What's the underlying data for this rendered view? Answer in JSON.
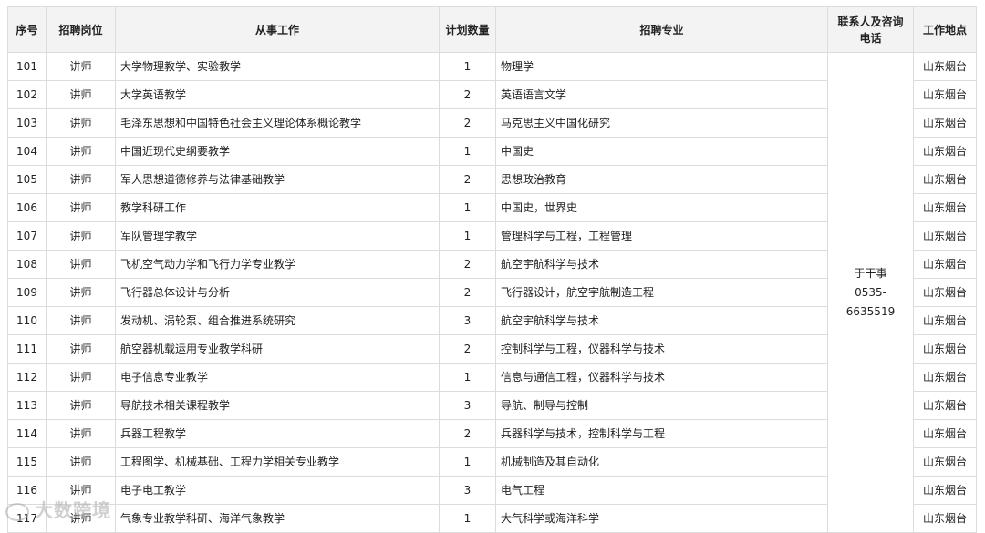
{
  "headers": {
    "seq": "序号",
    "post": "招聘岗位",
    "work": "从事工作",
    "count": "计划数量",
    "major": "招聘专业",
    "contact": "联系人及咨询电话",
    "location": "工作地点"
  },
  "contact": {
    "name": "于干事",
    "phone_1": "0535-",
    "phone_2": "6635519"
  },
  "rows": [
    {
      "seq": "101",
      "post": "讲师",
      "work": "大学物理教学、实验教学",
      "count": "1",
      "major": "物理学",
      "location": "山东烟台"
    },
    {
      "seq": "102",
      "post": "讲师",
      "work": "大学英语教学",
      "count": "2",
      "major": "英语语言文学",
      "location": "山东烟台"
    },
    {
      "seq": "103",
      "post": "讲师",
      "work": "毛泽东思想和中国特色社会主义理论体系概论教学",
      "count": "2",
      "major": "马克思主义中国化研究",
      "location": "山东烟台"
    },
    {
      "seq": "104",
      "post": "讲师",
      "work": "中国近现代史纲要教学",
      "count": "1",
      "major": "中国史",
      "location": "山东烟台"
    },
    {
      "seq": "105",
      "post": "讲师",
      "work": "军人思想道德修养与法律基础教学",
      "count": "2",
      "major": "思想政治教育",
      "location": "山东烟台"
    },
    {
      "seq": "106",
      "post": "讲师",
      "work": "教学科研工作",
      "count": "1",
      "major": "中国史，世界史",
      "location": "山东烟台"
    },
    {
      "seq": "107",
      "post": "讲师",
      "work": "军队管理学教学",
      "count": "1",
      "major": "管理科学与工程，工程管理",
      "location": "山东烟台"
    },
    {
      "seq": "108",
      "post": "讲师",
      "work": "飞机空气动力学和飞行力学专业教学",
      "count": "2",
      "major": "航空宇航科学与技术",
      "location": "山东烟台"
    },
    {
      "seq": "109",
      "post": "讲师",
      "work": "飞行器总体设计与分析",
      "count": "2",
      "major": "飞行器设计，航空宇航制造工程",
      "location": "山东烟台"
    },
    {
      "seq": "110",
      "post": "讲师",
      "work": "发动机、涡轮泵、组合推进系统研究",
      "count": "3",
      "major": "航空宇航科学与技术",
      "location": "山东烟台"
    },
    {
      "seq": "111",
      "post": "讲师",
      "work": "航空器机载运用专业教学科研",
      "count": "2",
      "major": "控制科学与工程，仪器科学与技术",
      "location": "山东烟台"
    },
    {
      "seq": "112",
      "post": "讲师",
      "work": "电子信息专业教学",
      "count": "1",
      "major": "信息与通信工程，仪器科学与技术",
      "location": "山东烟台"
    },
    {
      "seq": "113",
      "post": "讲师",
      "work": "导航技术相关课程教学",
      "count": "3",
      "major": "导航、制导与控制",
      "location": "山东烟台"
    },
    {
      "seq": "114",
      "post": "讲师",
      "work": "兵器工程教学",
      "count": "2",
      "major": "兵器科学与技术，控制科学与工程",
      "location": "山东烟台"
    },
    {
      "seq": "115",
      "post": "讲师",
      "work": "工程图学、机械基础、工程力学相关专业教学",
      "count": "1",
      "major": "机械制造及其自动化",
      "location": "山东烟台"
    },
    {
      "seq": "116",
      "post": "讲师",
      "work": "电子电工教学",
      "count": "3",
      "major": "电气工程",
      "location": "山东烟台"
    },
    {
      "seq": "117",
      "post": "讲师",
      "work": "气象专业教学科研、海洋气象教学",
      "count": "1",
      "major": "大气科学或海洋科学",
      "location": "山东烟台"
    }
  ],
  "watermark": "大数跨境"
}
